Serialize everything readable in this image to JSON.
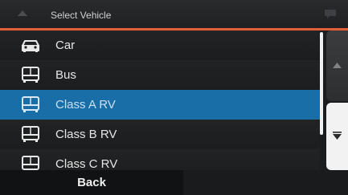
{
  "header": {
    "title": "Select Vehicle",
    "left_icon": "up-arrow-icon",
    "right_icon": "message-icon",
    "accent_color": "#e0603a"
  },
  "vehicles": [
    {
      "label": "Car",
      "icon": "car-icon",
      "selected": false
    },
    {
      "label": "Bus",
      "icon": "bus-icon",
      "selected": false
    },
    {
      "label": "Class A RV",
      "icon": "bus-icon",
      "selected": true
    },
    {
      "label": "Class B RV",
      "icon": "bus-icon",
      "selected": false
    },
    {
      "label": "Class C RV",
      "icon": "bus-icon",
      "selected": false
    }
  ],
  "scroll": {
    "up_icon": "scroll-up-arrow-icon",
    "down_icon": "scroll-down-arrow-icon"
  },
  "footer": {
    "back_label": "Back"
  },
  "colors": {
    "selected_row": "#1a6ea8"
  }
}
